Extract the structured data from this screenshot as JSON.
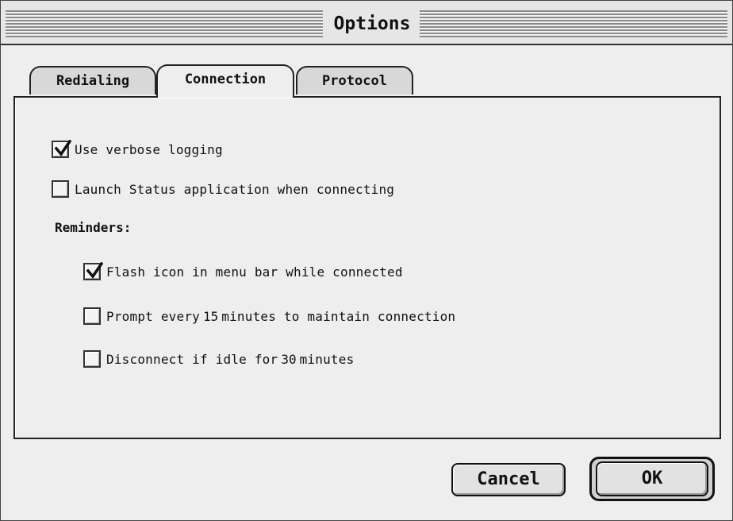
{
  "window": {
    "title": "Options"
  },
  "tabs": [
    {
      "label": "Redialing",
      "active": false
    },
    {
      "label": "Connection",
      "active": true
    },
    {
      "label": "Protocol",
      "active": false
    }
  ],
  "options": {
    "verbose_logging": {
      "label": "Use verbose logging",
      "checked": true
    },
    "launch_status": {
      "label": "Launch Status application when connecting",
      "checked": false
    }
  },
  "reminders": {
    "heading": "Reminders:",
    "flash_icon": {
      "label": "Flash icon in menu bar while connected",
      "checked": true
    },
    "prompt": {
      "prefix": "Prompt every",
      "minutes": "15",
      "suffix": "minutes to maintain connection",
      "checked": false
    },
    "disconnect": {
      "prefix": "Disconnect if idle for",
      "minutes": "30",
      "suffix": "minutes",
      "checked": false
    }
  },
  "buttons": {
    "cancel": "Cancel",
    "ok": "OK"
  },
  "colors": {
    "window_bg": "#eeeeee",
    "tab_inactive": "#d8d8d8",
    "border": "#222222"
  }
}
